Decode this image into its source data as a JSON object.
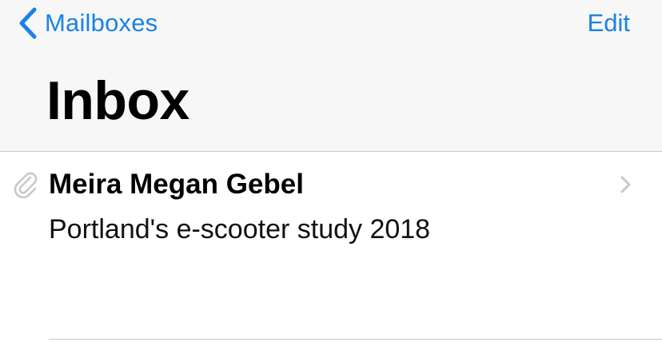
{
  "nav": {
    "back_label": "Mailboxes",
    "edit_label": "Edit"
  },
  "header": {
    "title": "Inbox"
  },
  "messages": [
    {
      "sender": "Meira Megan Gebel",
      "subject": "Portland's e-scooter study 2018",
      "has_attachment": true,
      "icons": {
        "attachment": "paperclip-icon",
        "disclosure": "chevron-right-icon"
      }
    }
  ],
  "colors": {
    "accent": "#1a82e2",
    "header_background": "#f7f7f7",
    "separator": "#c8c7cc",
    "icon_gray": "#c7c7cc"
  }
}
